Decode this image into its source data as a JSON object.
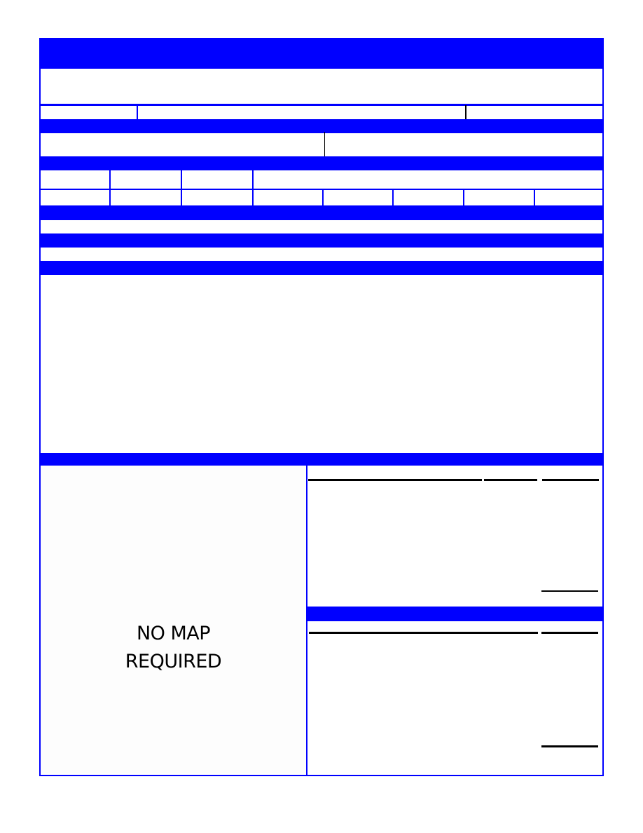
{
  "colors": {
    "accent": "#0000ff",
    "rule": "#000000"
  },
  "map": {
    "line1": "NO MAP",
    "line2": "REQUIRED"
  }
}
